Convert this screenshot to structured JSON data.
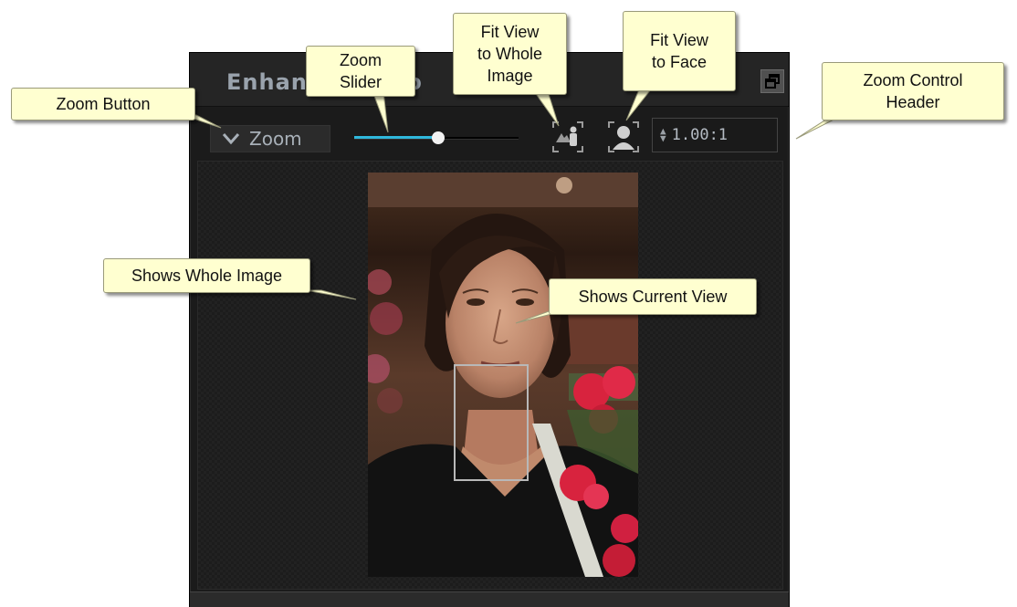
{
  "panel": {
    "title": "Enhance Photo",
    "zoom_button": {
      "label": "Zoom",
      "icon": "chevron-down-icon"
    },
    "zoom_slider": {
      "value_fraction": 0.51,
      "accent_color": "#2fb8dc"
    },
    "fit_whole_icon": "fit-whole-image-icon",
    "fit_face_icon": "fit-face-icon",
    "zoom_ratio": "1.00:1",
    "detach_icon": "detach-window-icon"
  },
  "callouts": {
    "zoom_button": "Zoom Button",
    "zoom_slider": "Zoom\nSlider",
    "fit_whole": "Fit View\nto Whole\nImage",
    "fit_face": "Fit View\nto Face",
    "zoom_header": "Zoom Control\nHeader",
    "whole_image": "Shows Whole Image",
    "current_view": "Shows Current View"
  },
  "colors": {
    "callout_bg": "#ffffd0",
    "panel_bg": "#1b1b1b"
  }
}
